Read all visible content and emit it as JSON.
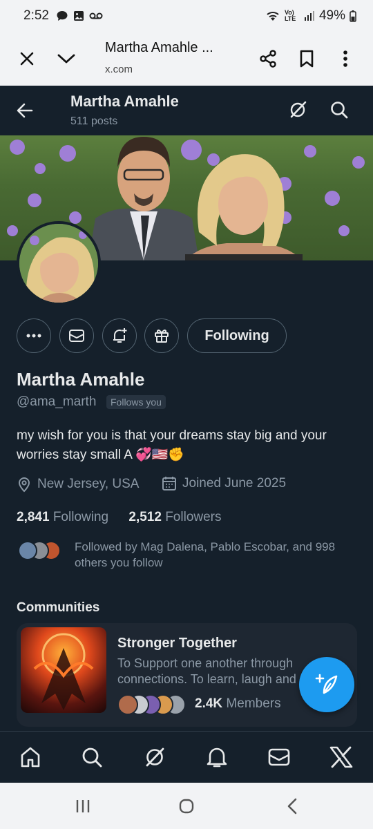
{
  "status_bar": {
    "time": "2:52",
    "battery": "49%",
    "network": "Vo) LTE",
    "icons": [
      "chat-bubble-icon",
      "gallery-icon",
      "voicemail-icon",
      "wifi-icon",
      "signal-icon",
      "battery-icon"
    ]
  },
  "browser_bar": {
    "page_title": "Martha Amahle ...",
    "domain": "x.com",
    "icons": [
      "close-icon",
      "chevron-down-icon",
      "share-icon",
      "bookmark-icon",
      "more-vertical-icon"
    ]
  },
  "header": {
    "name": "Martha Amahle",
    "posts": "511 posts"
  },
  "profile": {
    "name": "Martha Amahle",
    "handle": "@ama_marth",
    "follows_you": "Follows you",
    "bio": "my wish for you is that your dreams stay big and your worries stay small A 💞🇺🇸✊",
    "location": "New Jersey, USA",
    "joined": "Joined June 2025",
    "following_count": "2,841",
    "following_label": "Following",
    "followers_count": "2,512",
    "followers_label": "Followers",
    "followed_by": "Followed by Mag Dalena, Pablo Escobar, and 998 others you follow"
  },
  "actions": {
    "follow_button": "Following"
  },
  "communities": {
    "title": "Communities",
    "items": [
      {
        "name": "Stronger Together",
        "description": "To Support one another through connections. To learn, laugh and",
        "members_count": "2.4K",
        "members_label": "Members"
      }
    ]
  },
  "colors": {
    "background": "#15202b",
    "accent": "#1d9bf0",
    "text_primary": "#e7e9ea",
    "text_secondary": "#8b98a5"
  }
}
